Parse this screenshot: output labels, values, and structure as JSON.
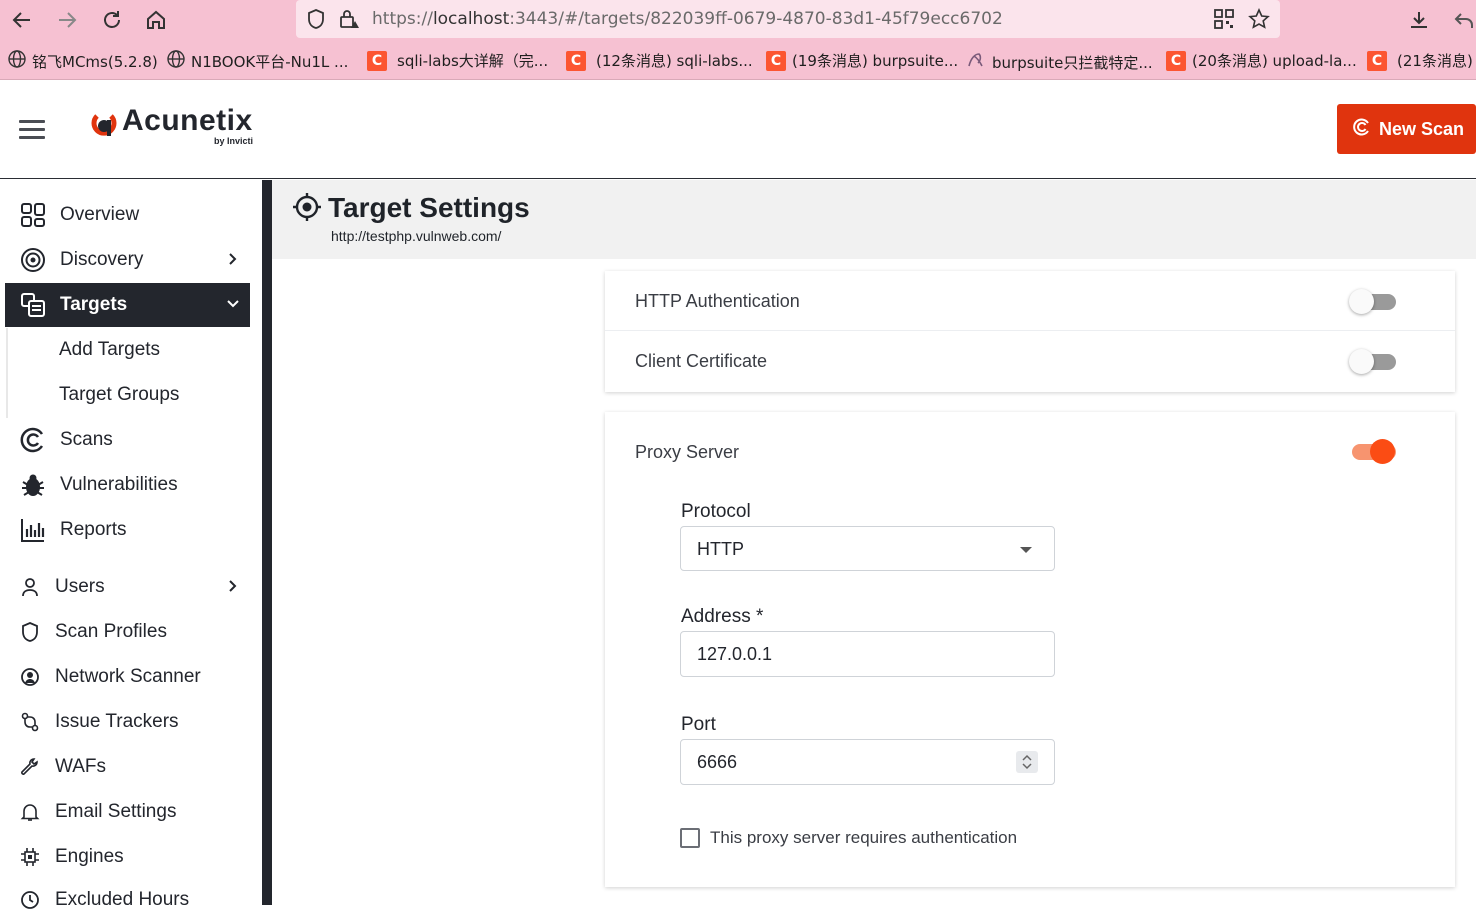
{
  "browser": {
    "url_prefix": "https://",
    "url_host": "localhost",
    "url_rest": ":3443/#/targets/822039ff-0679-4870-83d1-45f79ecc6702",
    "bookmarks": [
      {
        "label": "铭飞MCms(5.2.8)",
        "icon": "globe-icon"
      },
      {
        "label": "N1BOOK平台-Nu1L ...",
        "icon": "globe-icon"
      },
      {
        "label": "sqli-labs大详解（完...",
        "icon": "csdn-icon"
      },
      {
        "label": "(12条消息) sqli-labs...",
        "icon": "csdn-icon"
      },
      {
        "label": "(19条消息) burpsuite...",
        "icon": "csdn-icon"
      },
      {
        "label": "burpsuite只拦截特定...",
        "icon": "site-icon"
      },
      {
        "label": "(20条消息) upload-la...",
        "icon": "csdn-icon"
      },
      {
        "label": "(21条消息)",
        "icon": "csdn-icon"
      }
    ],
    "csdn_letter": "C"
  },
  "header": {
    "logo_name": "Acunetix",
    "logo_sub": "by Invicti",
    "new_scan_label": "New Scan",
    "accent": "#e0340e"
  },
  "sidebar": {
    "items": [
      {
        "label": "Overview",
        "icon": "overview-icon"
      },
      {
        "label": "Discovery",
        "icon": "discovery-icon"
      },
      {
        "label": "Targets",
        "icon": "targets-icon",
        "active": true
      },
      {
        "label": "Add Targets"
      },
      {
        "label": "Target Groups"
      },
      {
        "label": "Scans",
        "icon": "scans-icon"
      },
      {
        "label": "Vulnerabilities",
        "icon": "bug-icon"
      },
      {
        "label": "Reports",
        "icon": "reports-icon"
      },
      {
        "label": "Users",
        "icon": "user-icon"
      },
      {
        "label": "Scan Profiles",
        "icon": "shield-icon"
      },
      {
        "label": "Network Scanner",
        "icon": "network-scanner-icon"
      },
      {
        "label": "Issue Trackers",
        "icon": "issue-tracker-icon"
      },
      {
        "label": "WAFs",
        "icon": "wrench-icon"
      },
      {
        "label": "Email Settings",
        "icon": "bell-icon"
      },
      {
        "label": "Engines",
        "icon": "engine-icon"
      },
      {
        "label": "Excluded Hours",
        "icon": "clock-icon"
      }
    ]
  },
  "page": {
    "title": "Target Settings",
    "subtitle": "http://testphp.vulnweb.com/"
  },
  "auth_card": {
    "http_auth_label": "HTTP Authentication",
    "http_auth_enabled": false,
    "client_cert_label": "Client Certificate",
    "client_cert_enabled": false
  },
  "proxy_card": {
    "label": "Proxy Server",
    "enabled": true,
    "protocol_label": "Protocol",
    "protocol_value": "HTTP",
    "address_label": "Address *",
    "address_value": "127.0.0.1",
    "port_label": "Port",
    "port_value": "6666",
    "auth_checkbox_label": "This proxy server requires authentication",
    "auth_checked": false
  }
}
